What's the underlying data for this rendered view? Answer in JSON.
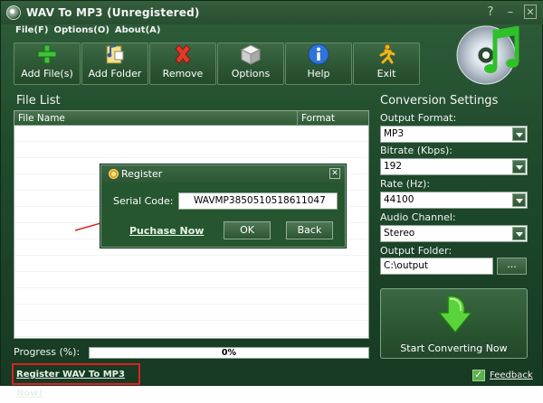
{
  "titlebar": {
    "title": "WAV To MP3  (Unregistered)",
    "help": "?",
    "minimize": "–",
    "close": "✕"
  },
  "menu": [
    "File(F)",
    "Options(O)",
    "About(A)"
  ],
  "toolbar": [
    {
      "label": "Add File(s)",
      "icon": "add-icon"
    },
    {
      "label": "Add Folder",
      "icon": "folder-icon"
    },
    {
      "label": "Remove",
      "icon": "remove-icon"
    },
    {
      "label": "Options",
      "icon": "options-icon"
    },
    {
      "label": "Help",
      "icon": "help-icon"
    },
    {
      "label": "Exit",
      "icon": "exit-icon"
    }
  ],
  "file_list": {
    "title": "File List",
    "columns": [
      "File Name",
      "Format"
    ]
  },
  "progress": {
    "label": "Progress (%):",
    "value": "0%"
  },
  "register_link": "Register WAV To MP3 Now!",
  "settings": {
    "title": "Conversion Settings",
    "output_format": {
      "label": "Output Format:",
      "value": "MP3"
    },
    "bitrate": {
      "label": "Bitrate (Kbps):",
      "value": "192"
    },
    "rate": {
      "label": "Rate (Hz):",
      "value": "44100"
    },
    "channel": {
      "label": "Audio Channel:",
      "value": "Stereo"
    },
    "folder": {
      "label": "Output Folder:",
      "value": "C:\\output",
      "browse": "..."
    },
    "start": "Start Converting Now"
  },
  "feedback": "Feedback",
  "dialog": {
    "title": "Register",
    "close": "✕",
    "serial_label": "Serial Code:",
    "serial_value": "WAVMP3850510518611047",
    "purchase": "Puchase Now",
    "ok": "OK",
    "back": "Back"
  },
  "colors": {
    "accent": "#265630",
    "highlight_red": "#e02020"
  }
}
